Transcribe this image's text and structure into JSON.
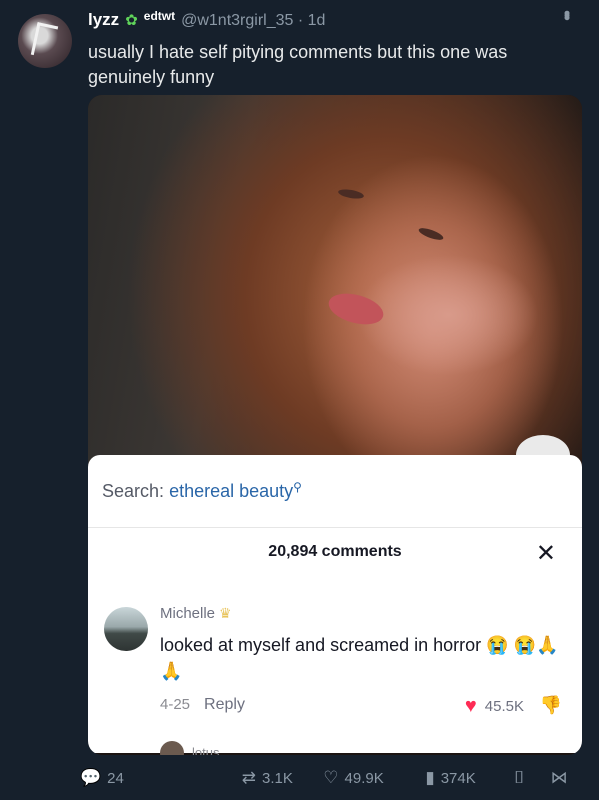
{
  "tweet": {
    "author_name": "lyzz",
    "badge": "edtwt",
    "handle_time": "@w1nt3rgirl_35 · 1d",
    "text": "usually I hate self pitying comments but this one was genuinely funny"
  },
  "overlay": {
    "search_label": "Search:",
    "search_term": "ethereal beauty",
    "comments_count": "20,894 comments",
    "comment": {
      "username": "Michelle",
      "text": "looked at myself and screamed in horror 😭 😭🙏🙏",
      "date": "4-25",
      "reply_label": "Reply",
      "likes": "45.5K"
    },
    "next_comment_username": "lotus"
  },
  "actions": {
    "replies": "24",
    "retweets": "3.1K",
    "likes": "49.9K",
    "views": "374K"
  },
  "colors": {
    "background": "#16202c",
    "accent_heart": "#fe2c55",
    "search_term": "#2a66a8"
  }
}
